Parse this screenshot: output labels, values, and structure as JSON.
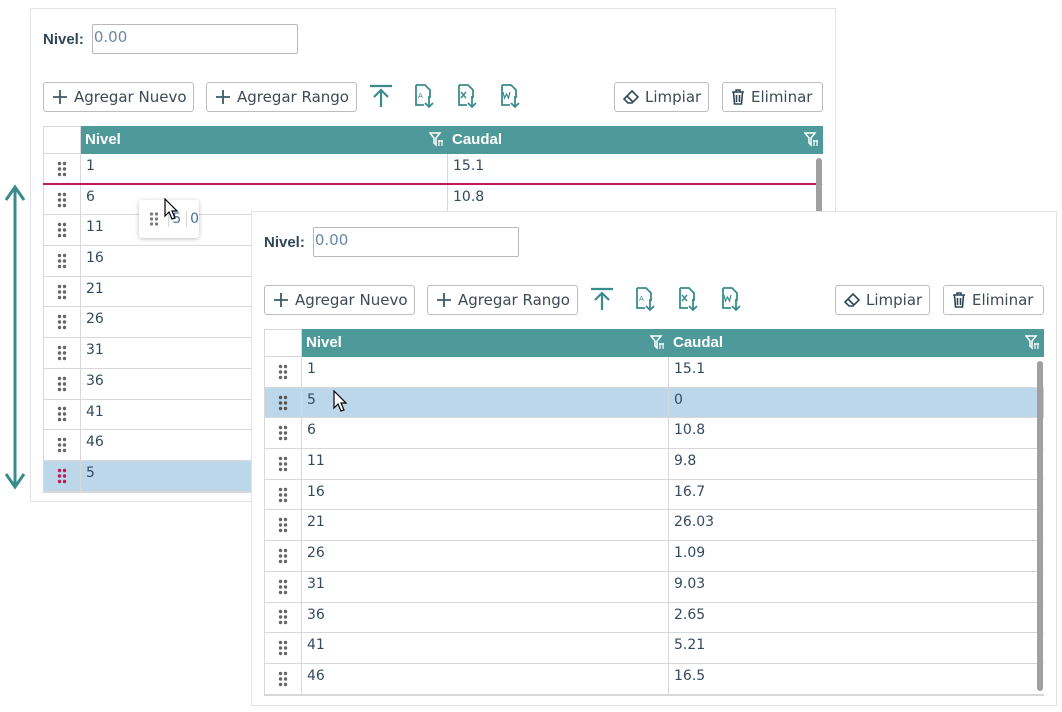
{
  "nivel_label": "Nivel:",
  "nivel_value": "0.00",
  "toolbar": {
    "add_new": "Agregar Nuevo",
    "add_range": "Agregar Rango",
    "clear": "Limpiar",
    "delete": "Eliminar"
  },
  "columns": {
    "nivel": "Nivel",
    "caudal": "Caudal"
  },
  "back_rows": [
    {
      "nivel": "1",
      "caudal": "15.1"
    },
    {
      "nivel": "6",
      "caudal": "10.8"
    },
    {
      "nivel": "11",
      "caudal": ""
    },
    {
      "nivel": "16",
      "caudal": ""
    },
    {
      "nivel": "21",
      "caudal": ""
    },
    {
      "nivel": "26",
      "caudal": ""
    },
    {
      "nivel": "31",
      "caudal": ""
    },
    {
      "nivel": "36",
      "caudal": ""
    },
    {
      "nivel": "41",
      "caudal": ""
    },
    {
      "nivel": "46",
      "caudal": ""
    },
    {
      "nivel": "5",
      "caudal": ""
    }
  ],
  "drag_ghost": {
    "nivel": "5",
    "caudal": "0"
  },
  "front_rows": [
    {
      "nivel": "1",
      "caudal": "15.1"
    },
    {
      "nivel": "5",
      "caudal": "0"
    },
    {
      "nivel": "6",
      "caudal": "10.8"
    },
    {
      "nivel": "11",
      "caudal": "9.8"
    },
    {
      "nivel": "16",
      "caudal": "16.7"
    },
    {
      "nivel": "21",
      "caudal": "26.03"
    },
    {
      "nivel": "26",
      "caudal": "1.09"
    },
    {
      "nivel": "31",
      "caudal": "9.03"
    },
    {
      "nivel": "36",
      "caudal": "2.65"
    },
    {
      "nivel": "41",
      "caudal": "5.21"
    },
    {
      "nivel": "46",
      "caudal": "16.5"
    }
  ],
  "colors": {
    "header": "#4e9a9a",
    "selected_row": "#bdd7ea",
    "drop_indicator": "#c2185b",
    "drag_arrow": "#3a8c8c"
  }
}
